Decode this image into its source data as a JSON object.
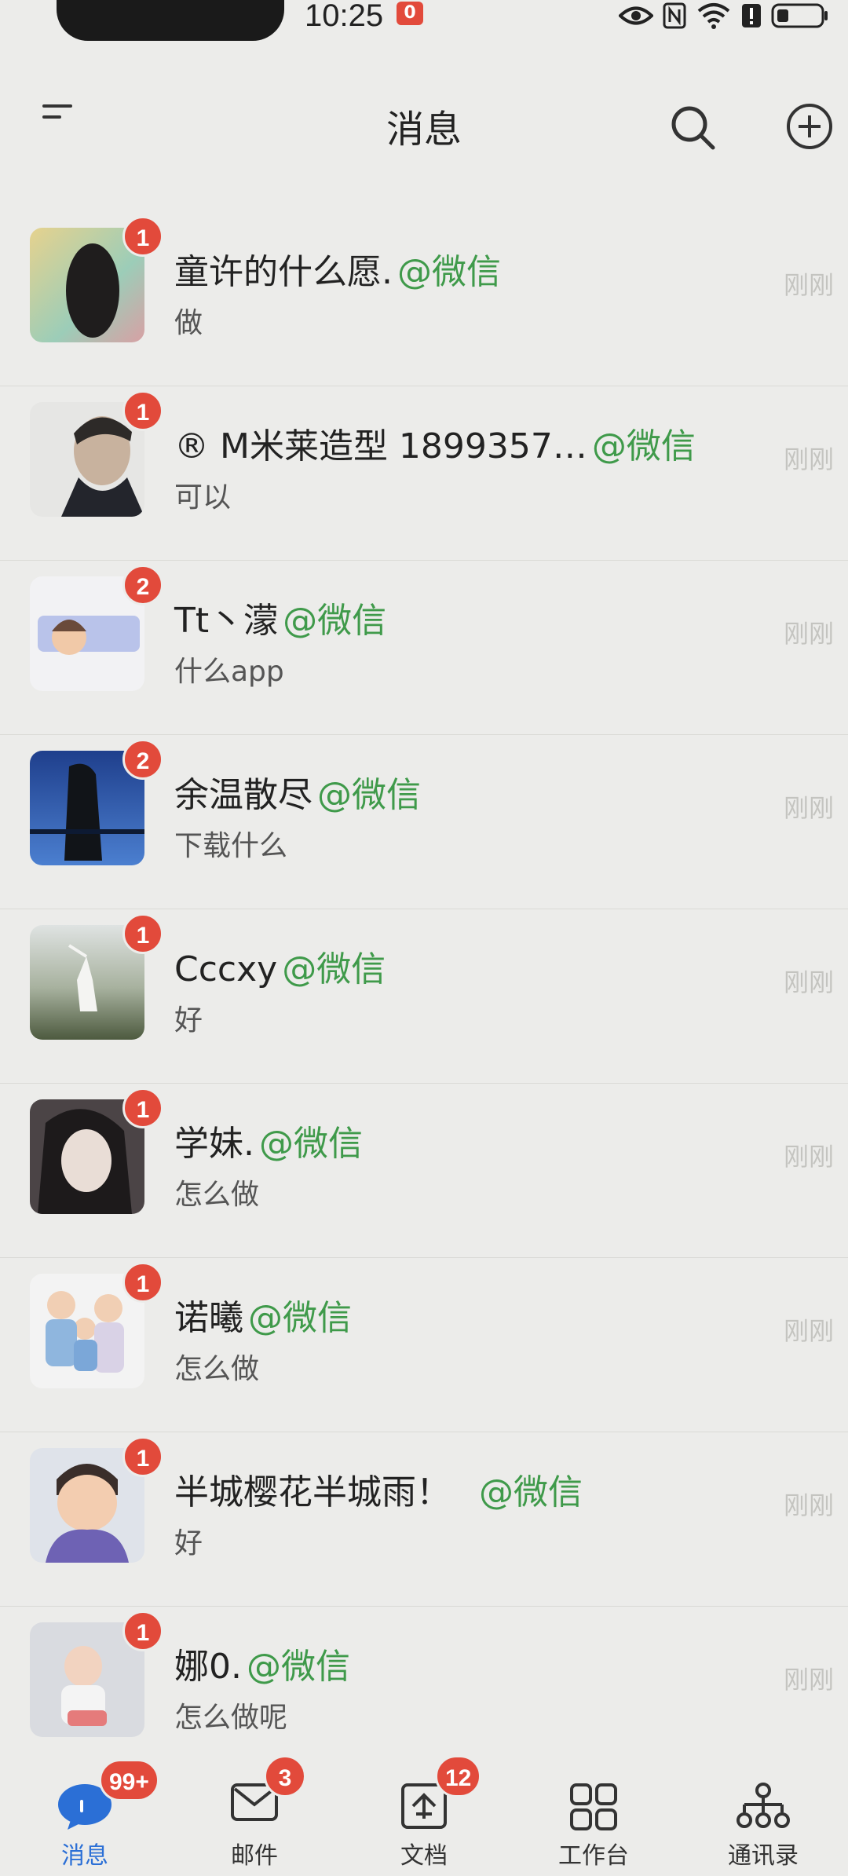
{
  "status_bar": {
    "time": "10:25",
    "notification_count": "0"
  },
  "header": {
    "title": "消息"
  },
  "chats": [
    {
      "name": "童许的什么愿.",
      "source": "@微信",
      "message": "做",
      "time": "刚刚",
      "unread": "1",
      "avatar_color": "#d4b36b"
    },
    {
      "name": "® M米莱造型 1899357…",
      "source": "@微信",
      "message": "可以",
      "time": "刚刚",
      "unread": "1",
      "avatar_color": "#5a5e66"
    },
    {
      "name": "Tt丶濛",
      "source": "@微信",
      "message": "什么app",
      "time": "刚刚",
      "unread": "2",
      "avatar_color": "#8fa2d8"
    },
    {
      "name": "余温散尽",
      "source": "@微信",
      "message": "下载什么",
      "time": "刚刚",
      "unread": "2",
      "avatar_color": "#2f5aa8"
    },
    {
      "name": "Cccxy",
      "source": "@微信",
      "message": "好",
      "time": "刚刚",
      "unread": "1",
      "avatar_color": "#7d8a6a"
    },
    {
      "name": "学妹.",
      "source": "@微信",
      "message": "怎么做",
      "time": "刚刚",
      "unread": "1",
      "avatar_color": "#3a3436"
    },
    {
      "name": "诺曦",
      "source": "@微信",
      "message": "怎么做",
      "time": "刚刚",
      "unread": "1",
      "avatar_color": "#9bbbd8"
    },
    {
      "name": "半城樱花半城雨！",
      "source": "@微信",
      "message": "好",
      "time": "刚刚",
      "unread": "1",
      "avatar_color": "#7a6fb8"
    },
    {
      "name": "娜0.",
      "source": "@微信",
      "message": "怎么做呢",
      "time": "刚刚",
      "unread": "1",
      "avatar_color": "#c9ccd3"
    }
  ],
  "tabs": [
    {
      "label": "消息",
      "badge": "99+",
      "icon": "chat-icon",
      "active": true
    },
    {
      "label": "邮件",
      "badge": "3",
      "icon": "mail-icon",
      "active": false
    },
    {
      "label": "文档",
      "badge": "12",
      "icon": "document-icon",
      "active": false
    },
    {
      "label": "工作台",
      "badge": "",
      "icon": "grid-icon",
      "active": false
    },
    {
      "label": "通讯录",
      "badge": "",
      "icon": "org-chart-icon",
      "active": false
    }
  ],
  "colors": {
    "badge": "#e24a3b",
    "source": "#3f9a4a",
    "active_tab": "#2b6fd6"
  }
}
